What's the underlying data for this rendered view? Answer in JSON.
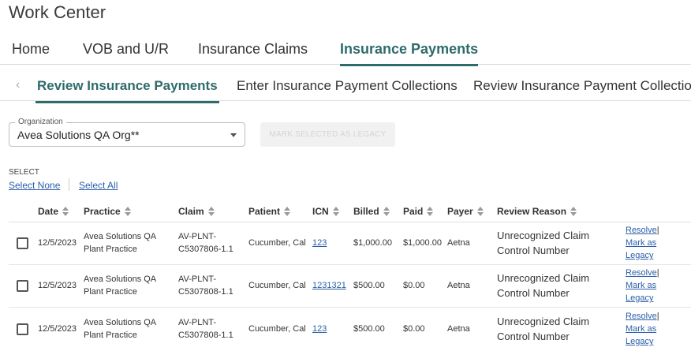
{
  "page_title": "Work Center",
  "main_tabs": [
    {
      "label": "Home"
    },
    {
      "label": "VOB and U/R"
    },
    {
      "label": "Insurance Claims"
    },
    {
      "label": "Insurance Payments",
      "active": true
    }
  ],
  "sub_tabs": [
    {
      "label": "Review Insurance Payments",
      "active": true
    },
    {
      "label": "Enter Insurance Payment Collections"
    },
    {
      "label": "Review Insurance Payment Collection"
    }
  ],
  "organization": {
    "label": "Organization",
    "value": "Avea Solutions QA Org**"
  },
  "legacy_button": "MARK SELECTED AS LEGACY",
  "select": {
    "label": "SELECT",
    "none": "Select None",
    "all": "Select All"
  },
  "columns": [
    "Date",
    "Practice",
    "Claim",
    "Patient",
    "ICN",
    "Billed",
    "Paid",
    "Payer",
    "Review Reason"
  ],
  "rows": [
    {
      "date": "12/5/2023",
      "practice": [
        "Avea Solutions QA",
        "Plant Practice"
      ],
      "claim": [
        "AV-PLNT-",
        "C5307806-1.1"
      ],
      "patient": "Cucumber, Cal",
      "icn": "123",
      "billed": "$1,000.00",
      "paid": "$1,000.00",
      "payer": "Aetna",
      "reason": [
        "Unrecognized Claim",
        "Control Number"
      ],
      "actions": {
        "resolve": "Resolve",
        "sep": "|",
        "mark1": "Mark as",
        "mark2": "Legacy"
      }
    },
    {
      "date": "12/5/2023",
      "practice": [
        "Avea Solutions QA",
        "Plant Practice"
      ],
      "claim": [
        "AV-PLNT-",
        "C5307808-1.1"
      ],
      "patient": "Cucumber, Cal",
      "icn": "1231321",
      "billed": "$500.00",
      "paid": "$0.00",
      "payer": "Aetna",
      "reason": [
        "Unrecognized Claim",
        "Control Number"
      ],
      "actions": {
        "resolve": "Resolve",
        "sep": "|",
        "mark1": "Mark as",
        "mark2": "Legacy"
      }
    },
    {
      "date": "12/5/2023",
      "practice": [
        "Avea Solutions QA",
        "Plant Practice"
      ],
      "claim": [
        "AV-PLNT-",
        "C5307808-1.1"
      ],
      "patient": "Cucumber, Cal",
      "icn": "123",
      "billed": "$500.00",
      "paid": "$0.00",
      "payer": "Aetna",
      "reason": [
        "Unrecognized Claim",
        "Control Number"
      ],
      "actions": {
        "resolve": "Resolve",
        "sep": "|",
        "mark1": "Mark as",
        "mark2": "Legacy"
      }
    }
  ]
}
